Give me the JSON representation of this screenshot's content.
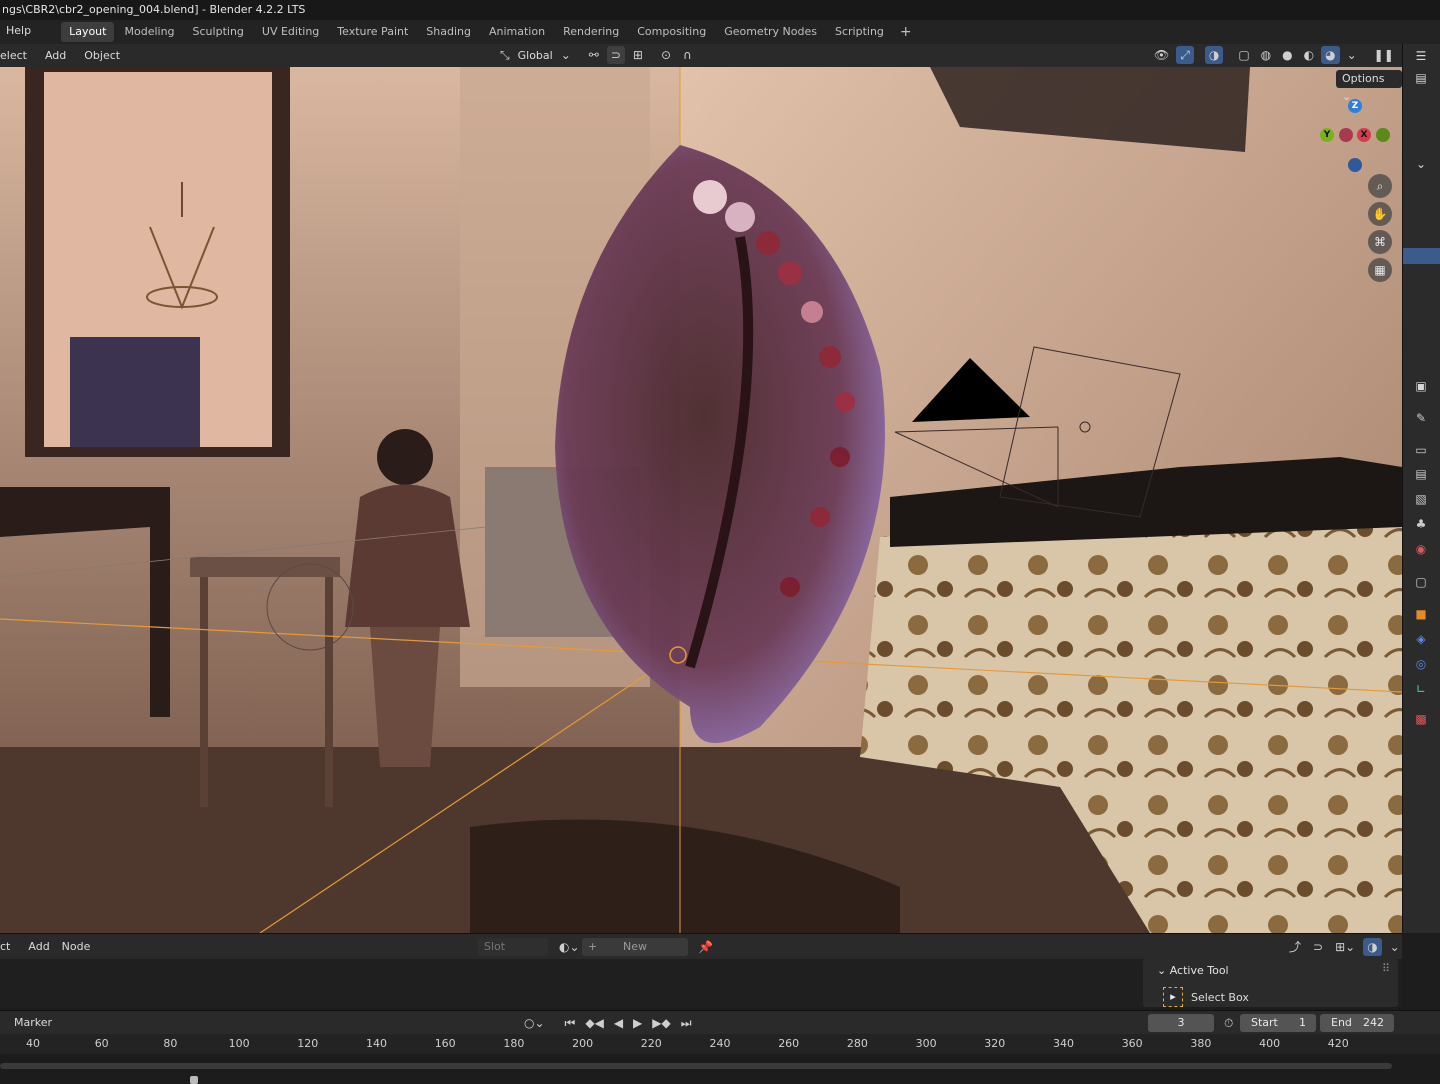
{
  "app": {
    "title": "ngs\\CBR2\\cbr2_opening_004.blend] - Blender 4.2.2 LTS"
  },
  "menubar": {
    "help": "Help",
    "workspaces": [
      "Layout",
      "Modeling",
      "Sculpting",
      "UV Editing",
      "Texture Paint",
      "Shading",
      "Animation",
      "Rendering",
      "Compositing",
      "Geometry Nodes",
      "Scripting"
    ],
    "active_workspace": "Layout",
    "add_workspace": "+"
  },
  "viewport_header": {
    "select": "elect",
    "add": "Add",
    "object": "Object",
    "orientation": "Global",
    "options": "Options"
  },
  "gizmo": {
    "z": "Z",
    "y": "Y",
    "x": "X",
    "colors": {
      "x": "#d63b4f",
      "y": "#7bb21b",
      "z": "#2f7fd9"
    }
  },
  "node_editor": {
    "select": "ct",
    "add": "Add",
    "node": "Node",
    "slot_placeholder": "Slot",
    "new_button": "New"
  },
  "active_tool_panel": {
    "title": "Active Tool",
    "tool": "Select Box"
  },
  "timeline": {
    "marker": "Marker",
    "current_frame": "3",
    "start_label": "Start",
    "start": "1",
    "end_label": "End",
    "end": "242",
    "ruler_ticks": [
      "40",
      "60",
      "80",
      "100",
      "120",
      "140",
      "160",
      "180",
      "200",
      "220",
      "240",
      "260",
      "280",
      "300",
      "320",
      "340",
      "360",
      "380",
      "400",
      "420"
    ]
  }
}
